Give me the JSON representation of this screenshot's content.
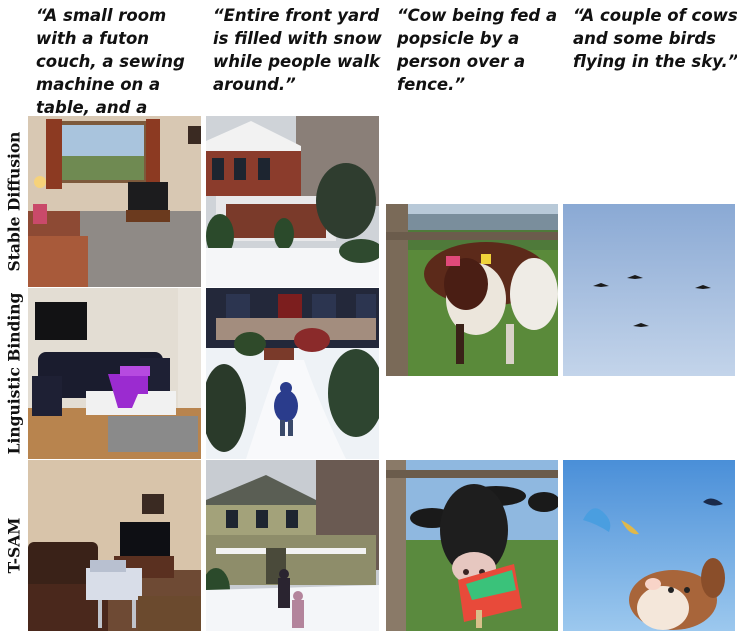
{
  "captions": [
    "“A small room with a futon couch, a sewing machine on a table, and a flatscreen TV.”",
    "“Entire front yard is filled with snow while people walk around.”",
    "“Cow being fed a popsicle by a person over a fence.”",
    "“A couple of cows and some birds flying in the sky.”"
  ],
  "rows": [
    "Stable Diffusion",
    "Linguistic Binding",
    "T-SAM"
  ]
}
